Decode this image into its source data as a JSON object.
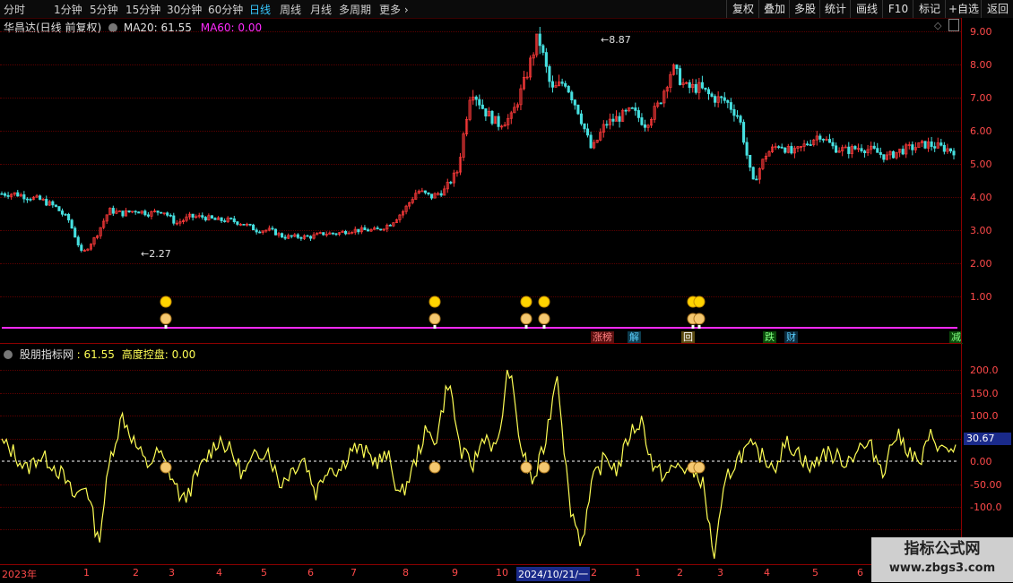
{
  "toolbar": {
    "left_items": [
      "分时",
      "1分钟",
      "5分钟",
      "15分钟",
      "30分钟",
      "60分钟",
      "日线",
      "周线",
      "月线",
      "多周期",
      "更多"
    ],
    "more_arrow": "›",
    "active": "日线",
    "right_items": [
      "复权",
      "叠加",
      "多股",
      "统计",
      "画线",
      "F10",
      "标记",
      "+自选",
      "返回"
    ]
  },
  "main_panel": {
    "stock_title": "华昌达(日线 前复权)",
    "ma20_label": "MA20: 61.55",
    "ma60_label": "MA60: 0.00",
    "low_annotation": "2.27",
    "high_annotation": "8.87",
    "y_ticks": [
      "9.00",
      "8.00",
      "7.00",
      "6.00",
      "5.00",
      "4.00",
      "3.00",
      "2.00",
      "1.00"
    ],
    "signals": [
      {
        "text": "涨榜",
        "color": "#ff8080",
        "bg": "#5a1010"
      },
      {
        "text": "解",
        "color": "#5ad0ff",
        "bg": "#0d3c4e"
      },
      {
        "text": "回",
        "color": "#ffffff",
        "bg": "#5a4a10"
      },
      {
        "text": "跌",
        "color": "#80ff80",
        "bg": "#0a4a0a"
      },
      {
        "text": "财",
        "color": "#5ad0ff",
        "bg": "#0d2c3e"
      },
      {
        "text": "减",
        "color": "#80ff80",
        "bg": "#0a4a0a"
      }
    ],
    "colors": {
      "up": "#ff3a3a",
      "down": "#46e0e0",
      "magenta": "#ff2aff"
    }
  },
  "indicator_panel": {
    "title": "股朋指标网",
    "value_label": ": 61.55",
    "sub_label": "高度控盘: 0.00",
    "current_value": "30.67",
    "y_ticks": [
      "200.0",
      "150.0",
      "100.0",
      "50.00",
      "0.00",
      "-50.00",
      "-100.0"
    ],
    "line_color": "#ffff55"
  },
  "x_axis": {
    "labels": [
      "2023年",
      "1",
      "2",
      "3",
      "4",
      "5",
      "6",
      "7",
      "8",
      "9",
      "10",
      "2024/10/21/一",
      "2",
      "1",
      "2",
      "3",
      "4",
      "5",
      "6"
    ]
  },
  "watermark": {
    "line1": "指标公式网",
    "line2": "www.zbgs3.com"
  },
  "chart_data": {
    "type": "candlestick",
    "title": "华昌达(日线 前复权)",
    "ylim": [
      0,
      9.5
    ],
    "annotations": [
      {
        "label": "2.27",
        "value": 2.27
      },
      {
        "label": "8.87",
        "value": 8.87
      }
    ],
    "price_path": [
      4.1,
      4.1,
      4.0,
      3.9,
      3.7,
      3.3,
      2.27,
      2.8,
      3.6,
      3.5,
      3.6,
      3.5,
      3.6,
      3.2,
      3.4,
      3.4,
      3.3,
      3.3,
      3.2,
      3.0,
      3.0,
      2.8,
      2.8,
      2.8,
      2.9,
      2.9,
      3.0,
      3.0,
      3.0,
      3.2,
      3.6,
      4.2,
      4.0,
      4.2,
      4.8,
      7.3,
      6.6,
      6.2,
      6.4,
      7.5,
      8.87,
      7.2,
      7.5,
      6.6,
      5.4,
      6.2,
      6.4,
      6.6,
      6.2,
      6.8,
      7.9,
      7.3,
      7.3,
      7.0,
      6.9,
      6.4,
      4.4,
      5.3,
      5.6,
      5.3,
      5.6,
      5.9,
      5.5,
      5.4,
      5.5,
      5.4,
      5.2,
      5.4,
      5.5,
      5.6,
      5.5,
      5.4
    ],
    "indicator": {
      "name": "股朋指标网",
      "ylim": [
        -210,
        240
      ],
      "values": [
        40,
        20,
        -20,
        10,
        0,
        -30,
        -80,
        -50,
        -180,
        10,
        100,
        40,
        -10,
        20,
        -30,
        -90,
        -40,
        10,
        50,
        20,
        -30,
        10,
        30,
        -50,
        -20,
        10,
        -70,
        -10,
        -20,
        30,
        20,
        0,
        10,
        -80,
        -20,
        60,
        50,
        180,
        20,
        -10,
        60,
        20,
        210,
        30,
        -50,
        40,
        200,
        -90,
        -180,
        -40,
        10,
        -20,
        60,
        90,
        -20,
        -30,
        -10,
        -20,
        -40,
        -210,
        -40,
        10,
        30,
        10,
        -10,
        40,
        20,
        -20,
        20,
        10,
        0,
        30,
        30,
        -20,
        60,
        30,
        -10,
        60,
        20,
        30
      ]
    }
  }
}
